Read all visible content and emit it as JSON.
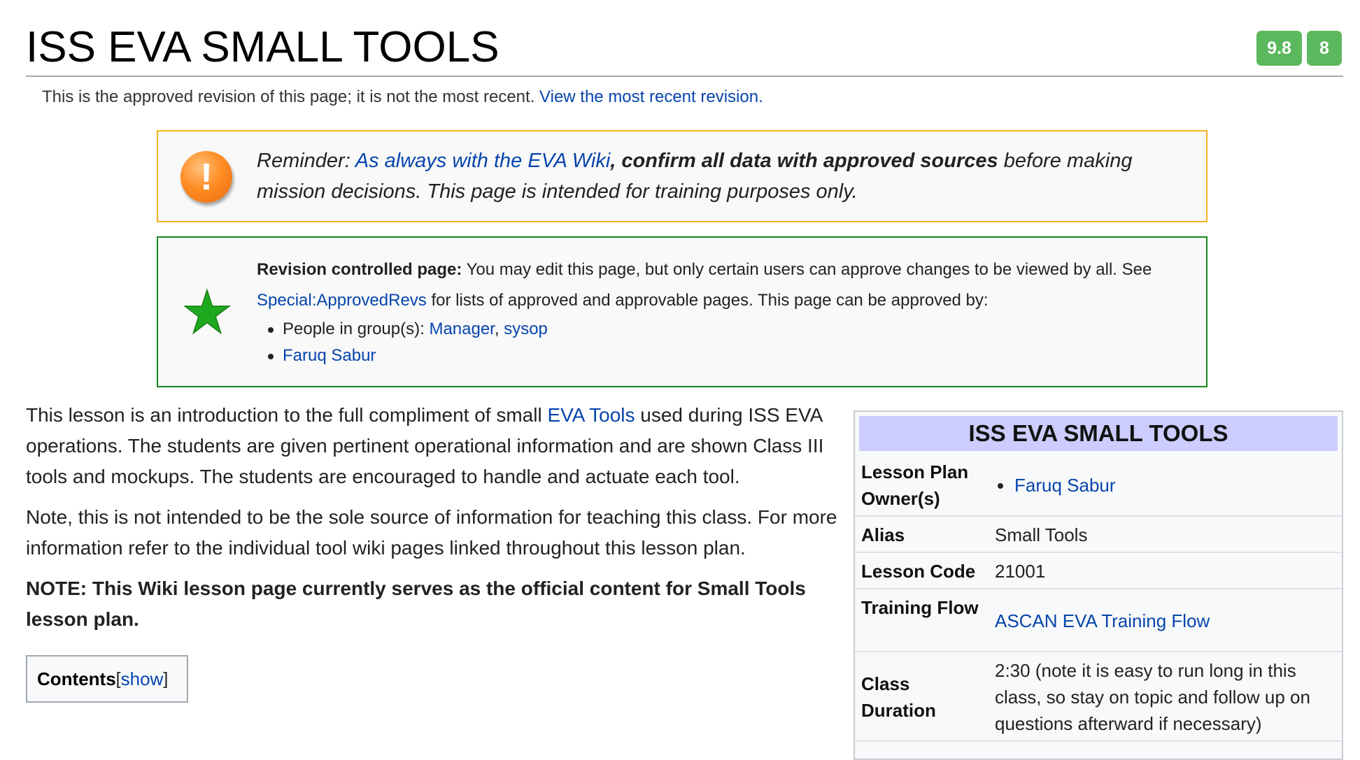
{
  "header": {
    "title": "ISS EVA SMALL TOOLS",
    "badge_score": "9.8",
    "badge_count": "8",
    "badge_color": "#5cb85c",
    "approved_notice": "This is the approved revision of this page; it is not the most recent.",
    "approved_link": "View the most recent revision."
  },
  "reminder": {
    "icon": "warning-exclamation-icon",
    "prefix": "Reminder: ",
    "link": "As always with the EVA Wiki",
    "bold": ", confirm all data with approved sources",
    "suffix": " before making mission decisions. This page is intended for training purposes only.",
    "border_color": "#f4b223"
  },
  "revision": {
    "icon": "green-star-icon",
    "bold": "Revision controlled page:",
    "text1": " You may edit this page, but only certain users can approve changes to be viewed by all. See ",
    "link": "Special:ApprovedRevs",
    "text2": " for lists of approved and approvable pages. This page can be approved by:",
    "groups_prefix": "People in group(s): ",
    "group1": "Manager",
    "group_sep": ", ",
    "group2": "sysop",
    "person": "Faruq Sabur",
    "border_color": "#14891c"
  },
  "body": {
    "p1_a": "This lesson is an introduction to the full compliment of small ",
    "p1_link": "EVA Tools",
    "p1_b": " used during ISS EVA operations. The students are given pertinent operational information and are shown Class III tools and mockups. The students are encouraged to handle and actuate each tool.",
    "p2": "Note, this is not intended to be the sole source of information for teaching this class. For more information refer to the individual tool wiki pages linked throughout this lesson plan.",
    "p3": "NOTE: This Wiki lesson page currently serves as the official content for Small Tools lesson plan."
  },
  "toc": {
    "title": "Contents",
    "open_bracket": " [",
    "toggle": "show",
    "close_bracket": "]"
  },
  "infobox": {
    "title": "ISS EVA SMALL TOOLS",
    "title_bg": "#ccccff",
    "rows": [
      {
        "label": "Lesson Plan Owner(s)",
        "value": "Faruq Sabur"
      },
      {
        "label": "Alias",
        "value": "Small Tools"
      },
      {
        "label": "Lesson Code",
        "value": "21001"
      },
      {
        "label": "Training Flow",
        "value": "ASCAN EVA Training Flow"
      },
      {
        "label": "Class Duration",
        "value": "2:30 (note it is easy to run long in this class, so stay on topic and follow up on questions afterward if necessary)"
      }
    ]
  }
}
